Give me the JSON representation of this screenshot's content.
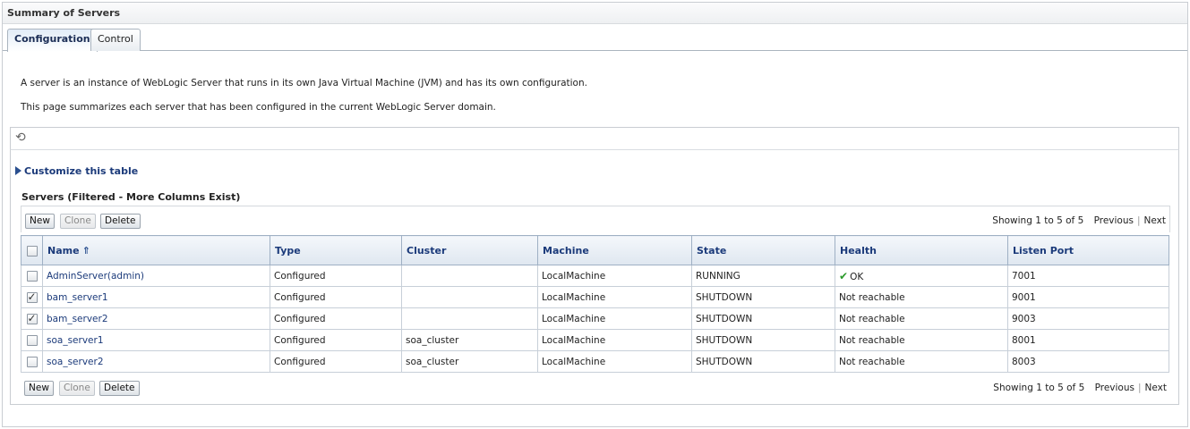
{
  "page": {
    "title": "Summary of Servers"
  },
  "tabs": [
    {
      "label": "Configuration",
      "active": true
    },
    {
      "label": "Control",
      "active": false
    }
  ],
  "intro": {
    "line1": "A server is an instance of WebLogic Server that runs in its own Java Virtual Machine (JVM) and has its own configuration.",
    "line2": "This page summarizes each server that has been configured in the current WebLogic Server domain."
  },
  "icons": {
    "refresh": "refresh-icon",
    "customize": "expand-triangle-icon",
    "sort": "sort-ascending-icon",
    "health_ok": "checkmark-icon"
  },
  "customize_label": "Customize this table",
  "table": {
    "title": "Servers (Filtered - More Columns Exist)",
    "buttons": {
      "new": "New",
      "clone": "Clone",
      "delete": "Delete"
    },
    "pager": {
      "showing": "Showing 1 to 5 of 5",
      "previous": "Previous",
      "next": "Next"
    },
    "columns": [
      "Name",
      "Type",
      "Cluster",
      "Machine",
      "State",
      "Health",
      "Listen Port"
    ],
    "rows": [
      {
        "checked": false,
        "name": "AdminServer(admin)",
        "type": "Configured",
        "cluster": "",
        "machine": "LocalMachine",
        "state": "RUNNING",
        "health": "OK",
        "port": "7001"
      },
      {
        "checked": true,
        "name": "bam_server1",
        "type": "Configured",
        "cluster": "",
        "machine": "LocalMachine",
        "state": "SHUTDOWN",
        "health": "Not reachable",
        "port": "9001"
      },
      {
        "checked": true,
        "name": "bam_server2",
        "type": "Configured",
        "cluster": "",
        "machine": "LocalMachine",
        "state": "SHUTDOWN",
        "health": "Not reachable",
        "port": "9003"
      },
      {
        "checked": false,
        "name": "soa_server1",
        "type": "Configured",
        "cluster": "soa_cluster",
        "machine": "LocalMachine",
        "state": "SHUTDOWN",
        "health": "Not reachable",
        "port": "8001"
      },
      {
        "checked": false,
        "name": "soa_server2",
        "type": "Configured",
        "cluster": "soa_cluster",
        "machine": "LocalMachine",
        "state": "SHUTDOWN",
        "health": "Not reachable",
        "port": "8003"
      }
    ]
  },
  "colors": {
    "link": "#1b3a7a",
    "ok": "#2b9a2b",
    "header_border": "#9fb0c4"
  }
}
